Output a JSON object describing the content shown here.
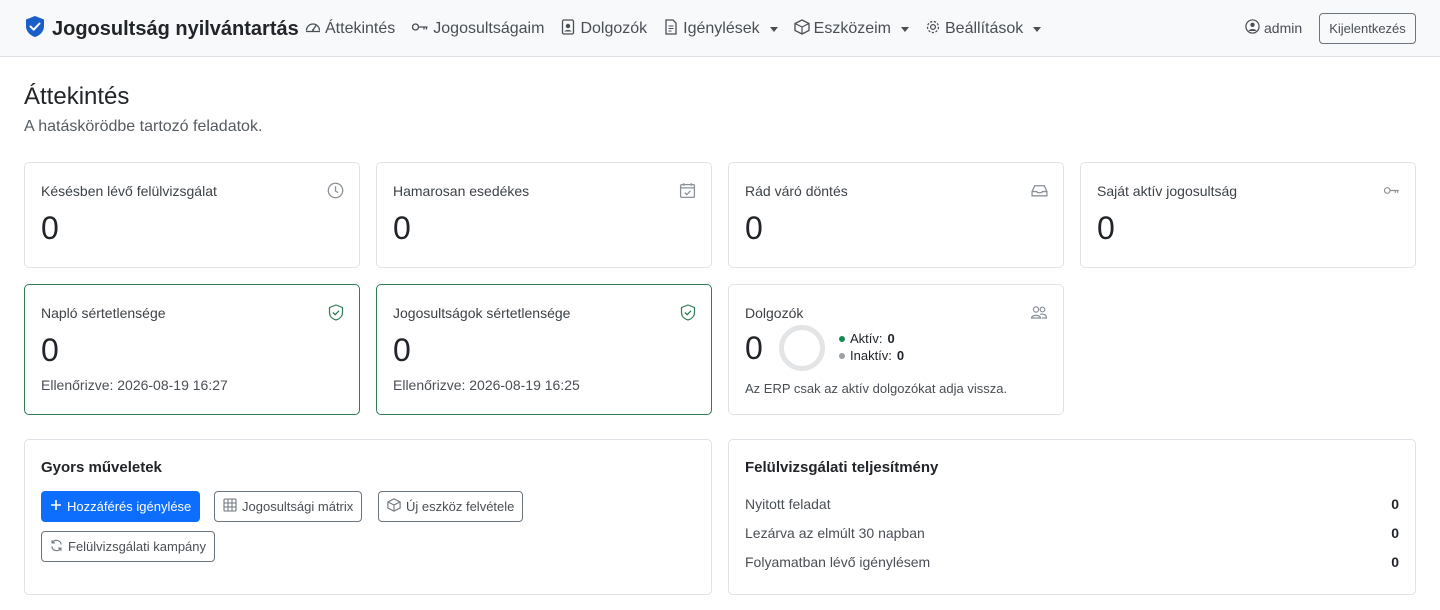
{
  "navbar": {
    "brand": "Jogosultság nyilvántartás",
    "items": [
      {
        "label": "Áttekintés",
        "icon": "dashboard-icon"
      },
      {
        "label": "Jogosultságaim",
        "icon": "key-icon"
      },
      {
        "label": "Dolgozók",
        "icon": "person-badge-icon"
      },
      {
        "label": "Igénylések",
        "icon": "file-text-icon",
        "dropdown": true
      },
      {
        "label": "Eszközeim",
        "icon": "box-icon",
        "dropdown": true
      },
      {
        "label": "Beállítások",
        "icon": "gear-icon",
        "dropdown": true
      }
    ],
    "user": "admin",
    "logout_label": "Kijelentkezés"
  },
  "header": {
    "title": "Áttekintés",
    "subtitle": "A hatáskörödbe tartozó feladatok."
  },
  "stats": [
    {
      "title": "Késésben lévő felülvizsgálat",
      "value": "0",
      "icon": "clock-icon"
    },
    {
      "title": "Hamarosan esedékes",
      "value": "0",
      "icon": "calendar-check-icon"
    },
    {
      "title": "Rád váró döntés",
      "value": "0",
      "icon": "inbox-icon"
    },
    {
      "title": "Saját aktív jogosultság",
      "value": "0",
      "icon": "key-icon"
    }
  ],
  "integrity": [
    {
      "title": "Napló sértetlensége",
      "value": "0",
      "checked": "Ellenőrizve: 2026-08-19 16:27",
      "icon": "shield-check-icon"
    },
    {
      "title": "Jogosultságok sértetlensége",
      "value": "0",
      "checked": "Ellenőrizve: 2026-08-19 16:25",
      "icon": "shield-check-icon"
    }
  ],
  "employees": {
    "title": "Dolgozók",
    "value": "0",
    "active_label": "Aktív:",
    "active_value": "0",
    "inactive_label": "Inaktív:",
    "inactive_value": "0",
    "note": "Az ERP csak az aktív dolgozókat adja vissza.",
    "colors": {
      "active": "#198754",
      "inactive": "#9aa0a6"
    }
  },
  "quick_actions": {
    "title": "Gyors műveletek",
    "buttons": [
      {
        "label": "Hozzáférés igénylése",
        "icon": "plus-icon",
        "style": "primary"
      },
      {
        "label": "Jogosultsági mátrix",
        "icon": "table-icon",
        "style": "outline"
      },
      {
        "label": "Új eszköz felvétele",
        "icon": "box-icon",
        "style": "outline"
      },
      {
        "label": "Felülvizsgálati kampány",
        "icon": "refresh-icon",
        "style": "outline"
      }
    ]
  },
  "performance": {
    "title": "Felülvizsgálati teljesítmény",
    "rows": [
      {
        "label": "Nyitott feladat",
        "value": "0"
      },
      {
        "label": "Lezárva az elmúlt 30 napban",
        "value": "0"
      },
      {
        "label": "Folyamatban lévő igénylésem",
        "value": "0"
      }
    ]
  },
  "colors": {
    "primary": "#0d6efd",
    "success_border": "#2e7d55",
    "brand_shield": "#1a5fc7"
  }
}
